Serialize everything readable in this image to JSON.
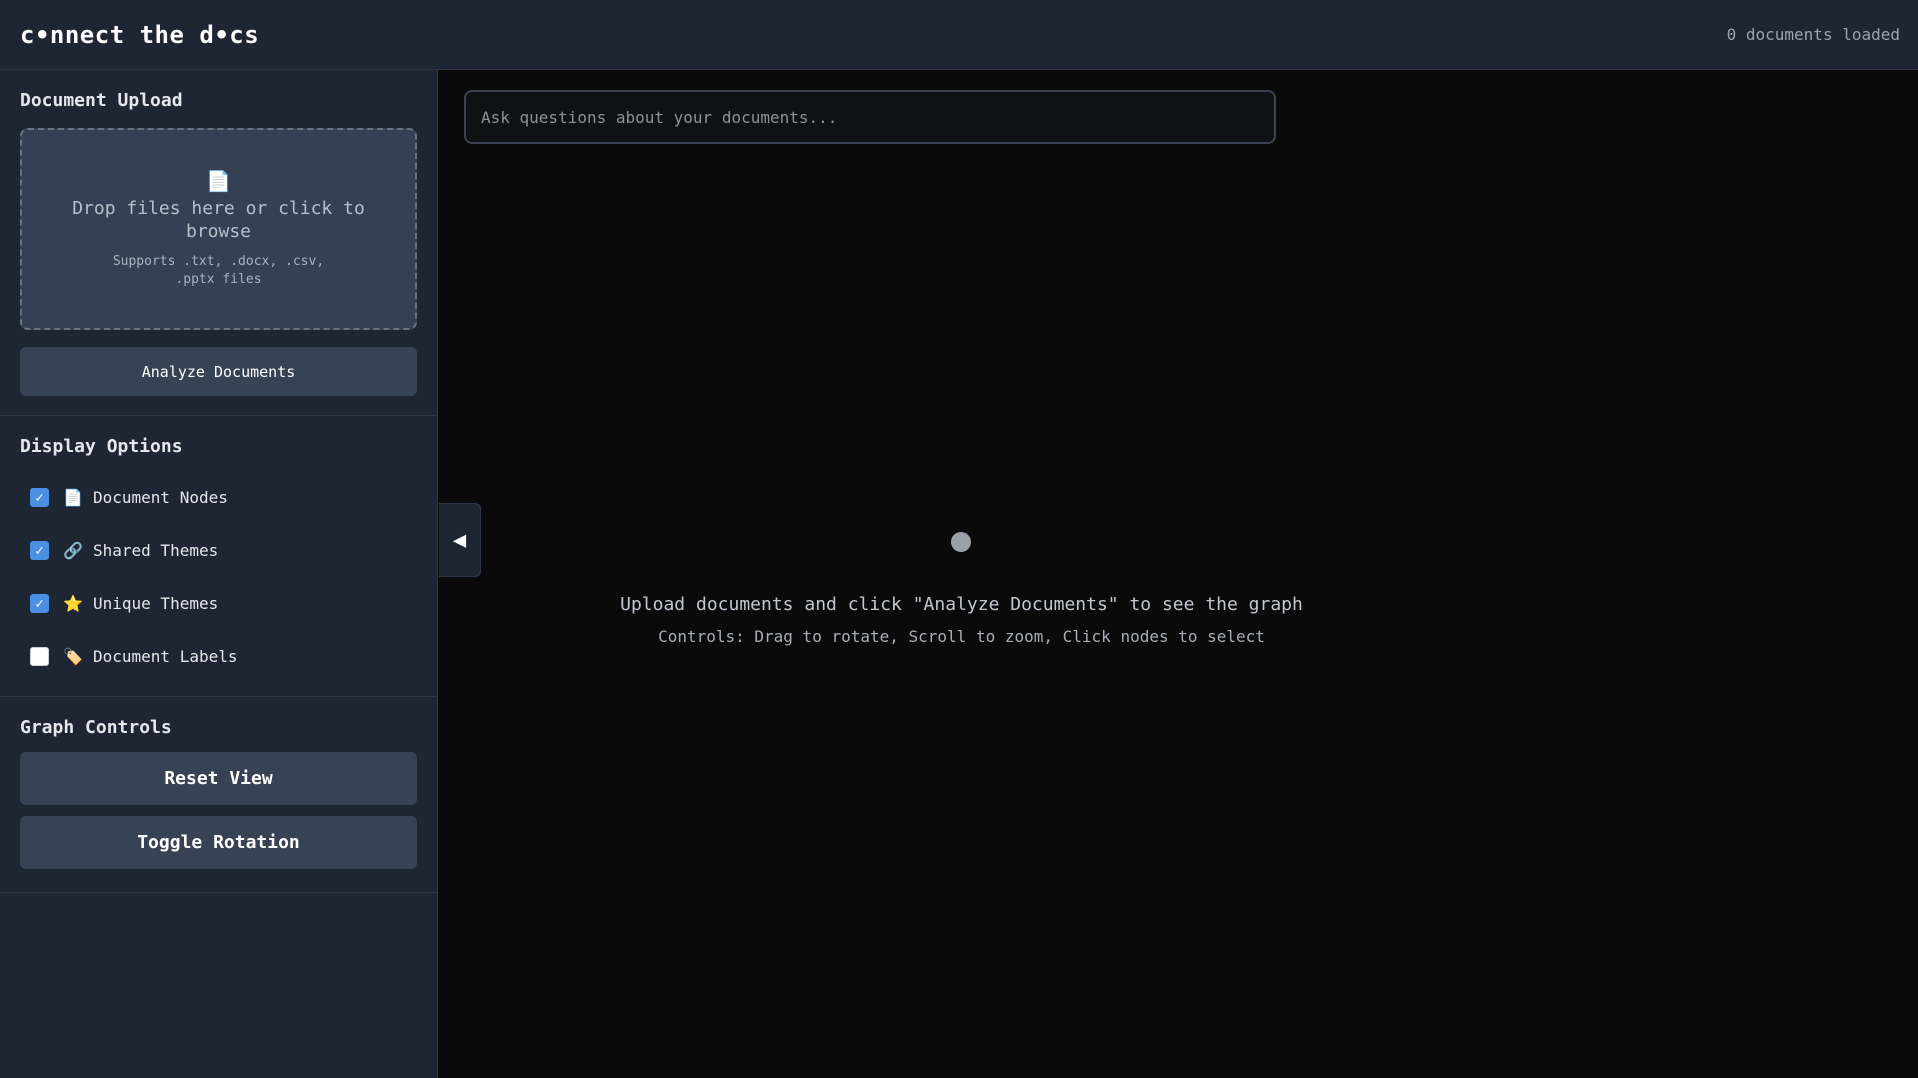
{
  "header": {
    "logo": "c•nnect the d•cs",
    "doc_count": "0 documents loaded"
  },
  "sidebar": {
    "upload": {
      "title": "Document Upload",
      "drop_icon": "file-icon",
      "drop_main": "Drop files here or click to browse",
      "drop_sub": "Supports .txt, .docx, .csv, .pptx files",
      "analyze_label": "Analyze Documents"
    },
    "display": {
      "title": "Display Options",
      "options": [
        {
          "label": "Document Nodes",
          "icon": "document-icon",
          "glyph": "📄",
          "checked": true
        },
        {
          "label": "Shared Themes",
          "icon": "link-icon",
          "glyph": "🔗",
          "checked": true
        },
        {
          "label": "Unique Themes",
          "icon": "star-icon",
          "glyph": "⭐",
          "checked": true
        },
        {
          "label": "Document Labels",
          "icon": "tag-icon",
          "glyph": "🏷️",
          "checked": false
        }
      ]
    },
    "graph": {
      "title": "Graph Controls",
      "reset_label": "Reset View",
      "toggle_label": "Toggle Rotation"
    }
  },
  "main": {
    "search_placeholder": "Ask questions about your documents...",
    "collapse_glyph": "◀",
    "empty_main": "Upload documents and click \"Analyze Documents\" to see the graph",
    "empty_sub": "Controls: Drag to rotate, Scroll to zoom, Click nodes to select"
  },
  "colors": {
    "panel_bg": "#1e2634",
    "button_bg": "#384255",
    "checkbox_accent": "#4b8fe2",
    "canvas_bg": "#0a0a0b"
  }
}
